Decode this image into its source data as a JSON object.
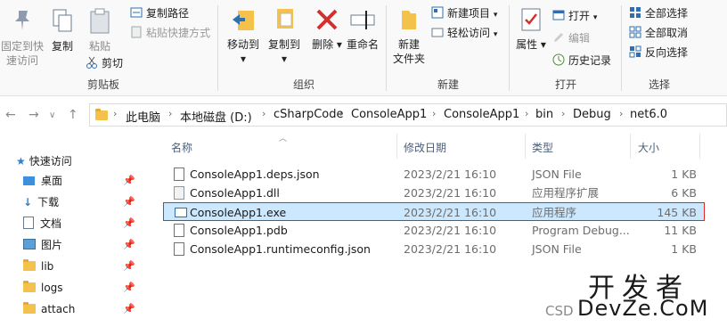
{
  "ribbon": {
    "clipboard": {
      "label": "剪贴板",
      "pin_line1": "固定到快",
      "pin_line2": "速访问",
      "copy": "复制",
      "paste": "粘贴",
      "copy_path": "复制路径",
      "paste_shortcut": "粘贴快捷方式",
      "cut": "剪切"
    },
    "organize": {
      "label": "组织",
      "move_to": "移动到",
      "copy_to": "复制到",
      "delete": "删除",
      "rename": "重命名"
    },
    "new": {
      "label": "新建",
      "new_folder_line1": "新建",
      "new_folder_line2": "文件夹",
      "new_item": "新建项目",
      "easy_access": "轻松访问"
    },
    "open": {
      "label": "打开",
      "properties": "属性",
      "open": "打开",
      "edit": "编辑",
      "history": "历史记录"
    },
    "select": {
      "label": "选择",
      "select_all": "全部选择",
      "select_none": "全部取消",
      "invert": "反向选择"
    }
  },
  "address": {
    "crumbs": [
      "此电脑",
      "本地磁盘 (D:)",
      "cSharpCode",
      "ConsoleApp1",
      "ConsoleApp1",
      "bin",
      "Debug",
      "net6.0"
    ]
  },
  "sidebar": {
    "quick_access": "快速访问",
    "items": [
      {
        "label": "桌面"
      },
      {
        "label": "下载"
      },
      {
        "label": "文档"
      },
      {
        "label": "图片"
      },
      {
        "label": "lib"
      },
      {
        "label": "logs"
      },
      {
        "label": "attach"
      }
    ]
  },
  "columns": {
    "name": "名称",
    "date": "修改日期",
    "type": "类型",
    "size": "大小"
  },
  "files": [
    {
      "name": "ConsoleApp1.deps.json",
      "date": "2023/2/21 16:10",
      "type": "JSON File",
      "size": "1 KB"
    },
    {
      "name": "ConsoleApp1.dll",
      "date": "2023/2/21 16:10",
      "type": "应用程序扩展",
      "size": "6 KB"
    },
    {
      "name": "ConsoleApp1.exe",
      "date": "2023/2/21 16:10",
      "type": "应用程序",
      "size": "145 KB"
    },
    {
      "name": "ConsoleApp1.pdb",
      "date": "2023/2/21 16:10",
      "type": "Program Debug...",
      "size": "11 KB"
    },
    {
      "name": "ConsoleApp1.runtimeconfig.json",
      "date": "2023/2/21 16:10",
      "type": "JSON File",
      "size": "1 KB"
    }
  ],
  "watermark": {
    "line1": "开发者",
    "line2": "DevZe.CoM",
    "prefix": "CSD"
  }
}
